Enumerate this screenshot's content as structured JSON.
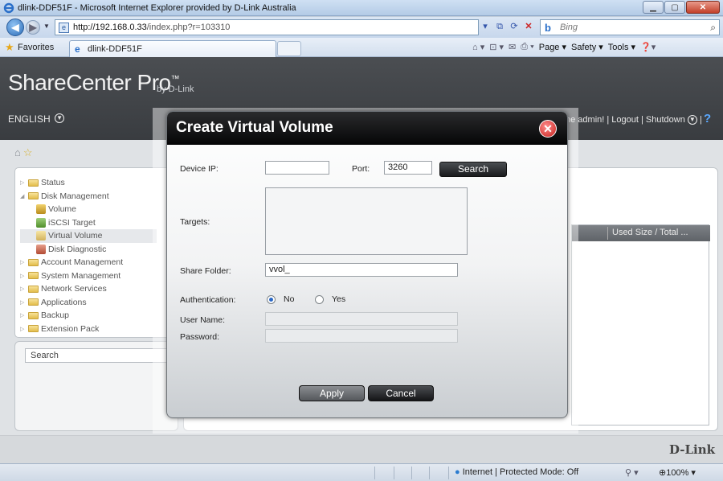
{
  "browser": {
    "window_title": "dlink-DDF51F - Microsoft Internet Explorer provided by D-Link Australia",
    "url_host": "http://192.168.0.33",
    "url_path": "/index.php?r=103310",
    "search_placeholder": "Bing",
    "favorites_label": "Favorites",
    "tab_title": "dlink-DDF51F",
    "commands": {
      "page": "Page",
      "safety": "Safety",
      "tools": "Tools"
    },
    "status_zone": "Internet | Protected Mode: Off",
    "zoom": "100%"
  },
  "app": {
    "brand": "ShareCenter Pro",
    "brand_tm": "™",
    "brand_by": "by D-Link",
    "language": "ENGLISH",
    "user_text": "ne admin! | Logout | Shutdown",
    "footer_logo": "D-Link"
  },
  "sidebar": {
    "items": [
      {
        "label": "Status"
      },
      {
        "label": "Disk Management"
      },
      {
        "label": "Volume"
      },
      {
        "label": "iSCSI Target"
      },
      {
        "label": "Virtual Volume"
      },
      {
        "label": "Disk Diagnostic"
      },
      {
        "label": "Account Management"
      },
      {
        "label": "System Management"
      },
      {
        "label": "Network Services"
      },
      {
        "label": "Applications"
      },
      {
        "label": "Backup"
      },
      {
        "label": "Extension Pack"
      }
    ],
    "search_placeholder": "Search"
  },
  "table": {
    "column_header": "Used Size / Total ..."
  },
  "modal": {
    "title": "Create Virtual Volume",
    "device_ip_label": "Device IP:",
    "device_ip_value": "",
    "port_label": "Port:",
    "port_value": "3260",
    "search_button": "Search",
    "targets_label": "Targets:",
    "share_folder_label": "Share Folder:",
    "share_folder_value": "vvol_",
    "authentication_label": "Authentication:",
    "auth_no": "No",
    "auth_yes": "Yes",
    "auth_selected": "No",
    "user_name_label": "User Name:",
    "password_label": "Password:",
    "apply_button": "Apply",
    "cancel_button": "Cancel"
  }
}
